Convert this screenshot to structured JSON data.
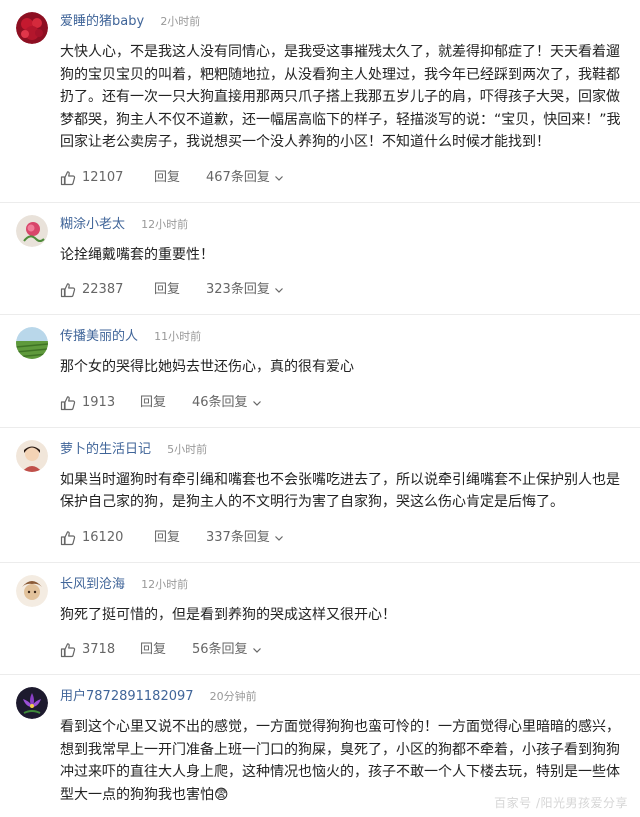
{
  "comments": [
    {
      "username": "爱睡的猪baby",
      "time": "2小时前",
      "text": "大快人心，不是我这人没有同情心，是我受这事摧残太久了，就差得抑郁症了！天天看着遛狗的宝贝宝贝的叫着，粑粑随地拉，从没看狗主人处理过，我今年已经踩到两次了，我鞋都扔了。还有一次一只大狗直接用那两只爪子搭上我那五岁儿子的肩，吓得孩子大哭，回家做梦都哭，狗主人不仅不道歉，还一幅居高临下的样子，轻描淡写的说：“宝贝，快回来！”我回家让老公卖房子，我说想买一个没人养狗的小区！不知道什么时候才能找到！",
      "likes": "12107",
      "reply_label": "回复",
      "replies": "467条回复",
      "avatar_color": "#b0142a"
    },
    {
      "username": "糊涂小老太",
      "time": "12小时前",
      "text": "论拴绳戴嘴套的重要性！",
      "likes": "22387",
      "reply_label": "回复",
      "replies": "323条回复",
      "avatar_color": "#d85b7a"
    },
    {
      "username": "传播美丽的人",
      "time": "11小时前",
      "text": "那个女的哭得比她妈去世还伤心，真的很有爱心",
      "likes": "1913",
      "reply_label": "回复",
      "replies": "46条回复",
      "avatar_color": "#4f8a3a"
    },
    {
      "username": "萝卜的生活日记",
      "time": "5小时前",
      "text": "如果当时遛狗时有牵引绳和嘴套也不会张嘴吃进去了，所以说牵引绳嘴套不止保护别人也是保护自己家的狗，是狗主人的不文明行为害了自家狗，哭这么伤心肯定是后悔了。",
      "likes": "16120",
      "reply_label": "回复",
      "replies": "337条回复",
      "avatar_color": "#e7c9a8"
    },
    {
      "username": "长风到沧海",
      "time": "12小时前",
      "text": "狗死了挺可惜的，但是看到养狗的哭成这样又很开心！",
      "likes": "3718",
      "reply_label": "回复",
      "replies": "56条回复",
      "avatar_color": "#c9a986"
    },
    {
      "username": "用户7872891182097",
      "time": "20分钟前",
      "text": "看到这个心里又说不出的感觉，一方面觉得狗狗也蛮可怜的！一方面觉得心里暗暗的感兴，想到我常早上一开门准备上班一门口的狗屎，臭死了，小区的狗都不牵着，小孩子看到狗狗冲过来吓的直往大人身上爬，这种情况也恼火的，孩子不敢一个人下楼去玩，特别是一些体型大一点的狗狗我也害怕😨",
      "likes": "",
      "reply_label": "",
      "replies": "",
      "avatar_color": "#7a3aa8"
    }
  ],
  "watermark": "百家号 /阳光男孩爱分享"
}
